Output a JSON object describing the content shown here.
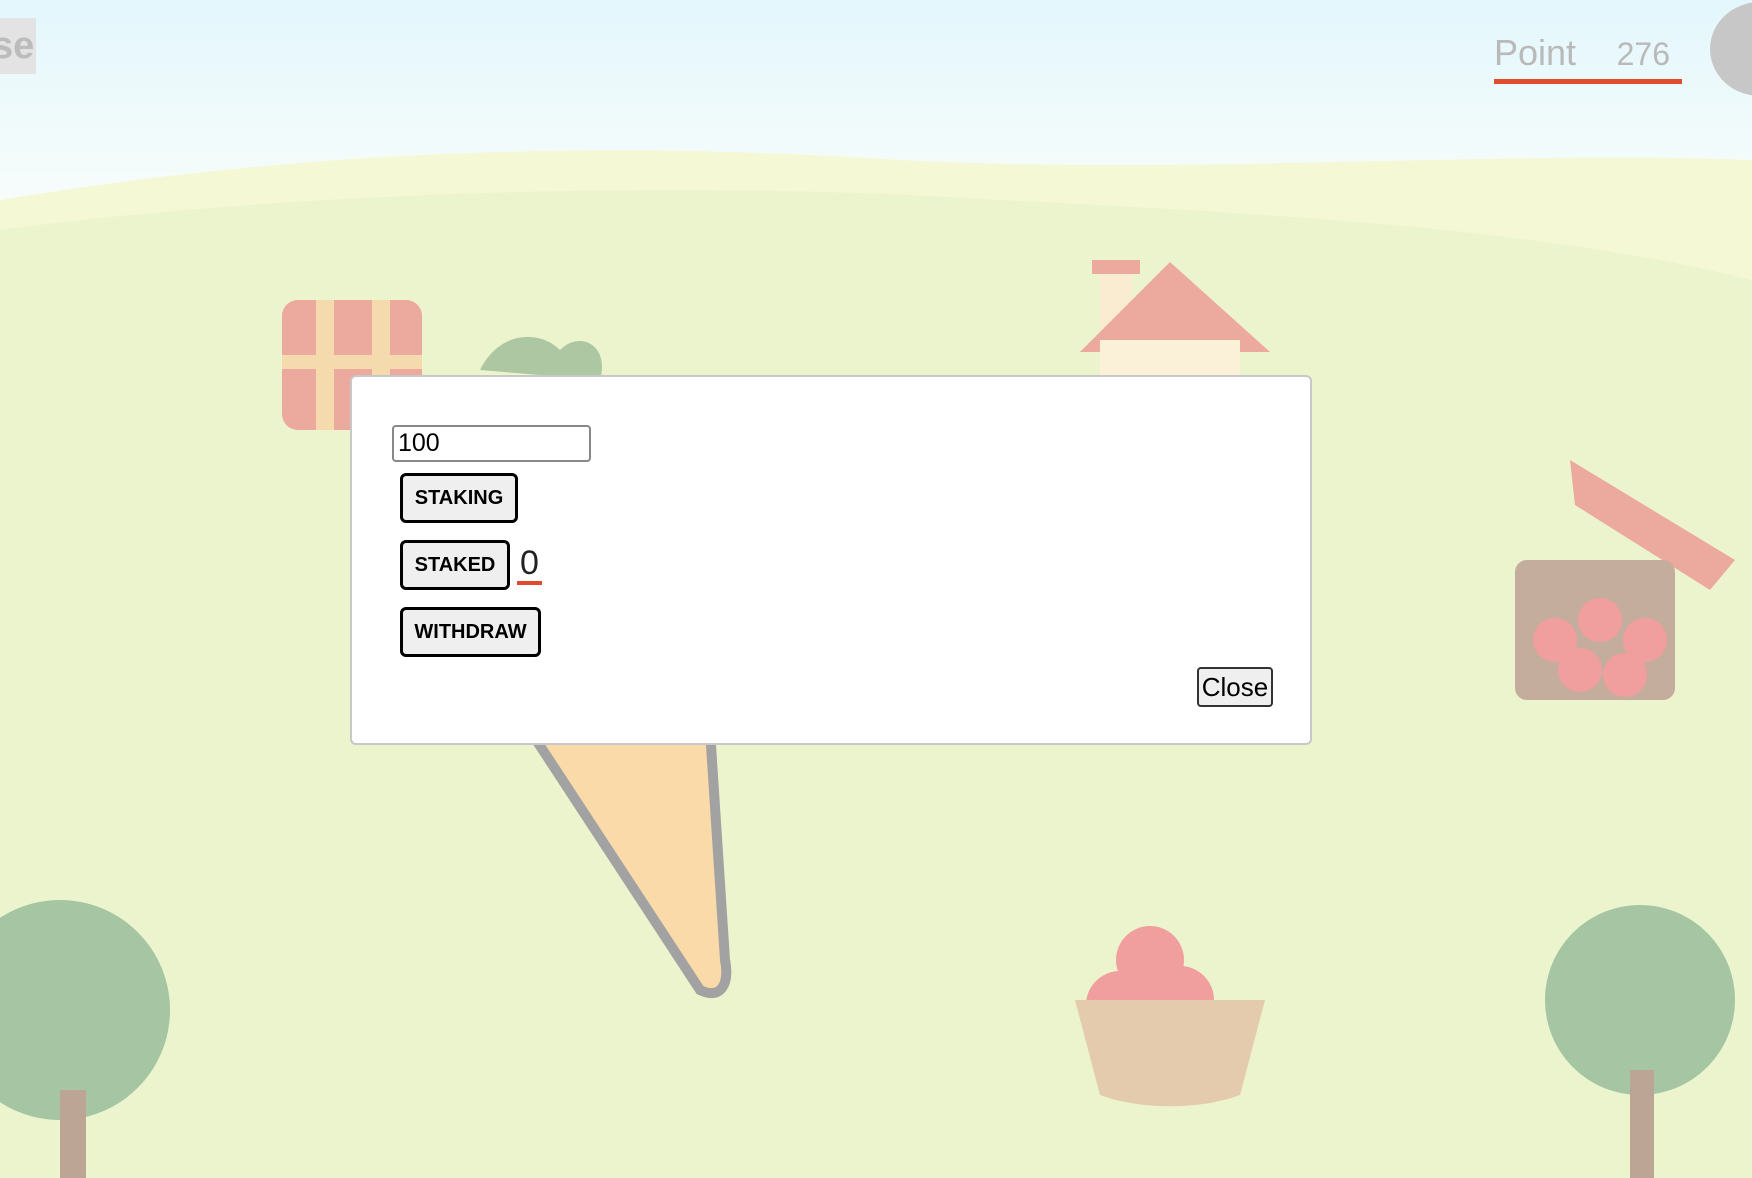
{
  "topbar": {
    "left_button_label": "se",
    "point_label": "Point",
    "point_value": "276"
  },
  "modal": {
    "amount_value": "100",
    "staking_label": "STAKING",
    "staked_label": "STAKED",
    "staked_value": "0",
    "withdraw_label": "WITHDRAW",
    "close_label": "Close"
  },
  "colors": {
    "accent": "#e04a2e",
    "sky": "#e2f6fb",
    "grass": "#eef6d2"
  },
  "icons": [
    "treasure-chest-icon",
    "house-icon",
    "carrot-icon",
    "fruit-stand-icon",
    "apple-basket-icon",
    "tree-icon"
  ]
}
